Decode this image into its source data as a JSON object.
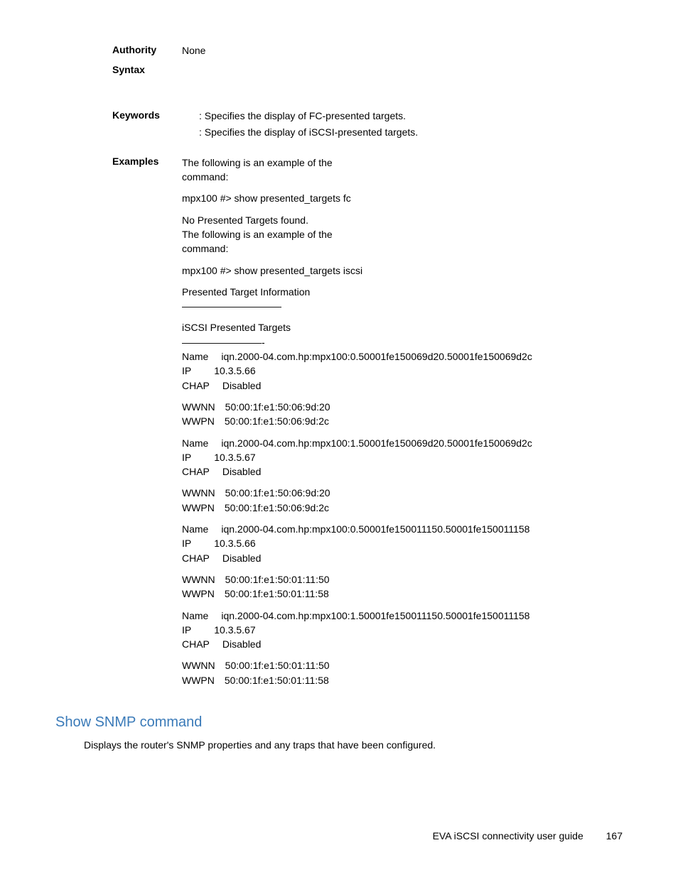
{
  "labels": {
    "authority": "Authority",
    "syntax": "Syntax",
    "keywords": "Keywords",
    "examples": "Examples"
  },
  "authority_value": "None",
  "keywords_lines": {
    "fc": ": Specifies the display of FC-presented targets.",
    "iscsi": ": Specifies the display of iSCSI-presented targets."
  },
  "examples": {
    "intro1a": "The following is an example of the",
    "intro1b": "command:",
    "cmd1": "mpx100 #> show presented_targets fc",
    "result1": "No Presented Targets found.",
    "intro2a": "The following is an example of the",
    "intro2b": "command:",
    "cmd2": "mpx100 #> show presented_targets iscsi",
    "header": "Presented Target Information",
    "dashes1": "——————————",
    "subheader": "iSCSI Presented Targets",
    "dashes2": "————————-",
    "t1_name_label": "Name",
    "t1_name": "iqn.2000-04.com.hp:mpx100:0.50001fe150069d20.50001fe150069d2c",
    "t1_ip_label": "IP",
    "t1_ip": "10.3.5.66",
    "t1_chap_label": "CHAP",
    "t1_chap": "Disabled",
    "t1_wwnn_label": "WWNN",
    "t1_wwnn": "50:00:1f:e1:50:06:9d:20",
    "t1_wwpn_label": "WWPN",
    "t1_wwpn": "50:00:1f:e1:50:06:9d:2c",
    "t2_name_label": "Name",
    "t2_name": "iqn.2000-04.com.hp:mpx100:1.50001fe150069d20.50001fe150069d2c",
    "t2_ip_label": "IP",
    "t2_ip": "10.3.5.67",
    "t2_chap_label": "CHAP",
    "t2_chap": "Disabled",
    "t2_wwnn_label": "WWNN",
    "t2_wwnn": "50:00:1f:e1:50:06:9d:20",
    "t2_wwpn_label": "WWPN",
    "t2_wwpn": "50:00:1f:e1:50:06:9d:2c",
    "t3_name_label": "Name",
    "t3_name": "iqn.2000-04.com.hp:mpx100:0.50001fe150011150.50001fe150011158",
    "t3_ip_label": "IP",
    "t3_ip": "10.3.5.66",
    "t3_chap_label": "CHAP",
    "t3_chap": "Disabled",
    "t3_wwnn_label": "WWNN",
    "t3_wwnn": "50:00:1f:e1:50:01:11:50",
    "t3_wwpn_label": "WWPN",
    "t3_wwpn": "50:00:1f:e1:50:01:11:58",
    "t4_name_label": "Name",
    "t4_name": "iqn.2000-04.com.hp:mpx100:1.50001fe150011150.50001fe150011158",
    "t4_ip_label": "IP",
    "t4_ip": "10.3.5.67",
    "t4_chap_label": "CHAP",
    "t4_chap": "Disabled",
    "t4_wwnn_label": "WWNN",
    "t4_wwnn": "50:00:1f:e1:50:01:11:50",
    "t4_wwpn_label": "WWPN",
    "t4_wwpn": "50:00:1f:e1:50:01:11:58"
  },
  "section": {
    "heading": "Show SNMP command",
    "body": "Displays the router's SNMP properties and any traps that have been configured."
  },
  "footer": {
    "title": "EVA iSCSI connectivity user guide",
    "page": "167"
  }
}
